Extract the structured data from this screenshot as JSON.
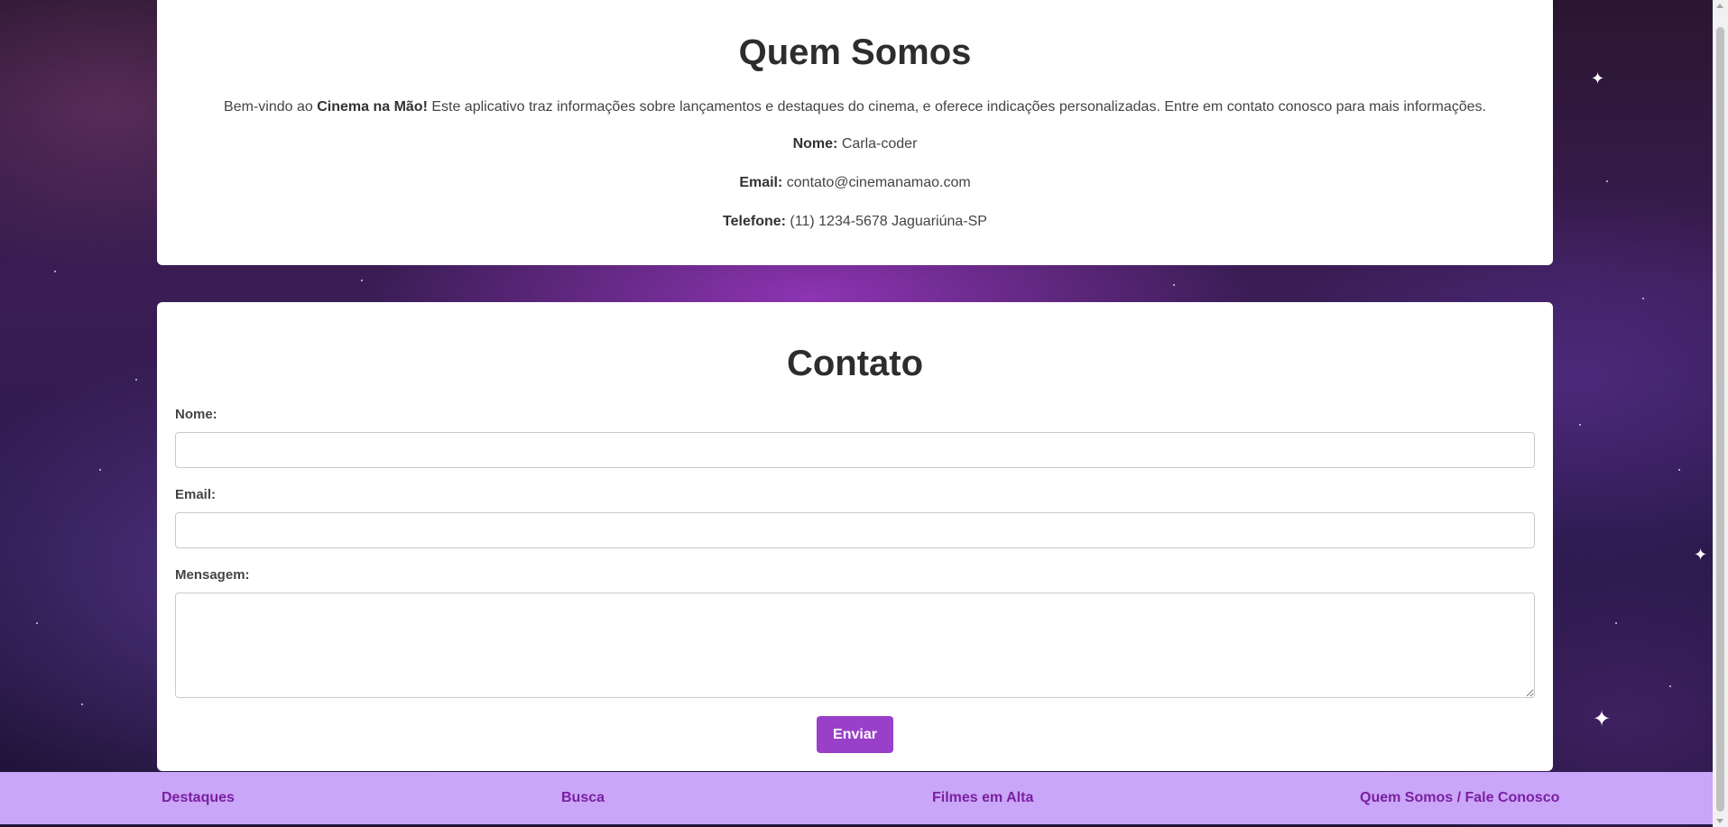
{
  "about": {
    "title": "Quem Somos",
    "intro_prefix": "Bem-vindo ao ",
    "intro_brand": "Cinema na Mão!",
    "intro_suffix": " Este aplicativo traz informações sobre lançamentos e destaques do cinema, e oferece indicações personalizadas. Entre em contato conosco para mais informações.",
    "name_label": "Nome:",
    "name_value": " Carla-coder",
    "email_label": "Email:",
    "email_value": " contato@cinemanamao.com",
    "phone_label": "Telefone:",
    "phone_value": " (11) 1234-5678 Jaguariúna-SP"
  },
  "contact": {
    "title": "Contato",
    "name_label": "Nome:",
    "name_value": "",
    "email_label": "Email:",
    "email_value": "",
    "message_label": "Mensagem:",
    "message_value": "",
    "submit_label": "Enviar"
  },
  "nav": {
    "items": [
      {
        "label": "Destaques"
      },
      {
        "label": "Busca"
      },
      {
        "label": "Filmes em Alta"
      },
      {
        "label": "Quem Somos / Fale Conosco"
      }
    ]
  },
  "colors": {
    "accent": "#9a3fc9",
    "nav_background": "#c9a6f7",
    "nav_text": "#7b1fa2"
  }
}
